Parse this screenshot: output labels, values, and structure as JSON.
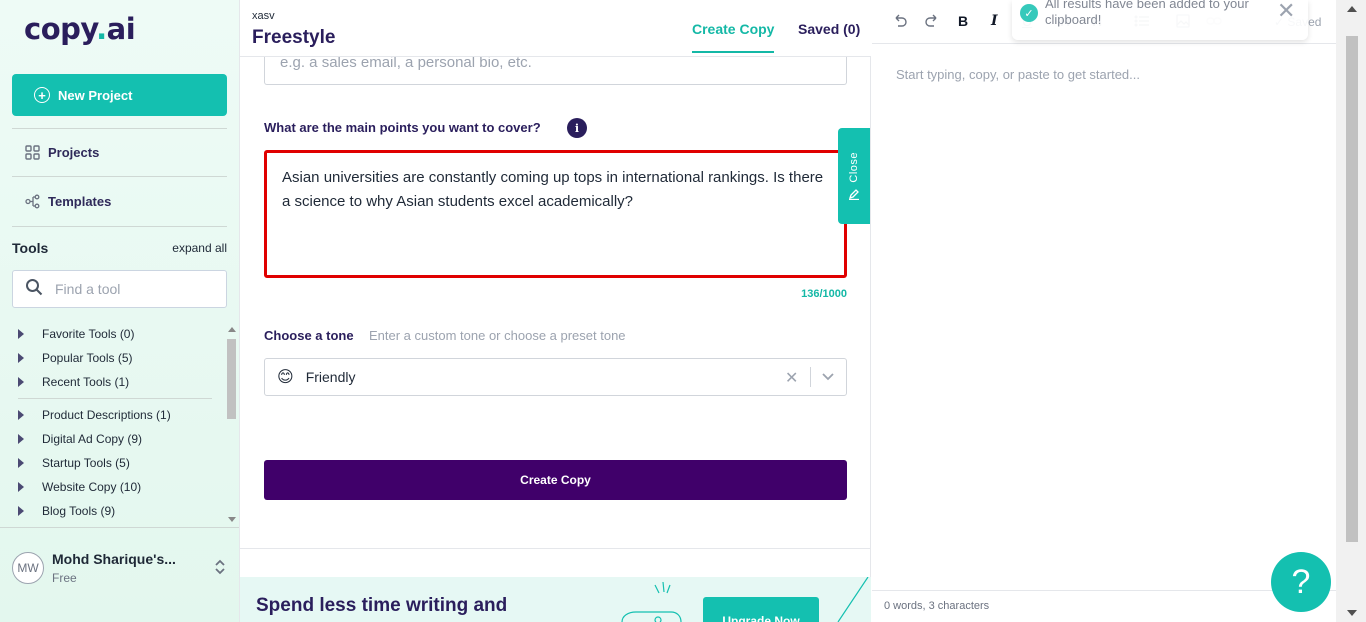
{
  "sidebar": {
    "logo": {
      "prefix": "copy",
      "dot": ".",
      "suffix": "ai"
    },
    "new_project_label": "New Project",
    "nav": {
      "projects": "Projects",
      "templates": "Templates"
    },
    "tools_title": "Tools",
    "expand_all": "expand all",
    "find_placeholder": "Find a tool",
    "tools_group_a": [
      {
        "label": "Favorite Tools (0)"
      },
      {
        "label": "Popular Tools (5)"
      },
      {
        "label": "Recent Tools (1)"
      }
    ],
    "tools_group_b": [
      {
        "label": "Product Descriptions (1)"
      },
      {
        "label": "Digital Ad Copy (9)"
      },
      {
        "label": "Startup Tools (5)"
      },
      {
        "label": "Website Copy (10)"
      },
      {
        "label": "Blog Tools (9)"
      }
    ],
    "user": {
      "initials": "MW",
      "name": "Mohd Sharique's...",
      "plan": "Free"
    }
  },
  "main": {
    "project_sub": "xasv",
    "project_title": "Freestyle",
    "tabs": {
      "create": "Create Copy",
      "saved": "Saved (0)"
    },
    "top_input_placeholder": "e.g. a sales email, a personal bio, etc.",
    "points_label": "What are the main points you want to cover?",
    "info_icon": "i",
    "points_value": "Asian universities are constantly coming up tops in international rankings. Is there a science to why Asian students excel academically?",
    "char_count": "136/1000",
    "tone_label": "Choose a tone",
    "tone_hint": "Enter a custom tone or choose a preset tone",
    "tone_emoji": "😊",
    "tone_value": "Friendly",
    "create_button": "Create Copy",
    "promo_text": "Spend less time writing and",
    "promo_button": "Upgrade Now",
    "close_tab": "Close"
  },
  "editor": {
    "toast_message": "All results have been added to your clipboard!",
    "saved_label": "Saved",
    "placeholder": "Start typing, copy, or paste to get started...",
    "footer": "0 words, 3 characters",
    "help": "?"
  }
}
